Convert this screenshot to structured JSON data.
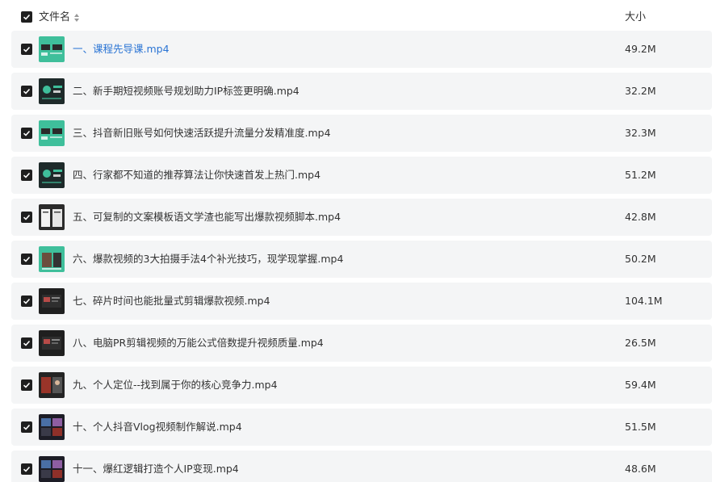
{
  "header": {
    "name_label": "文件名",
    "size_label": "大小"
  },
  "files": [
    {
      "name": "一、课程先导课.mp4",
      "size": "49.2M",
      "thumb": "green",
      "active": true
    },
    {
      "name": "二、新手期短视频账号规划助力IP标签更明确.mp4",
      "size": "32.2M",
      "thumb": "dark-green"
    },
    {
      "name": "三、抖音新旧账号如何快速活跃提升流量分发精准度.mp4",
      "size": "32.3M",
      "thumb": "green"
    },
    {
      "name": "四、行家都不知道的推荐算法让你快速首发上热门.mp4",
      "size": "51.2M",
      "thumb": "dark-green"
    },
    {
      "name": "五、可复制的文案模板语文学渣也能写出爆款视频脚本.mp4",
      "size": "42.8M",
      "thumb": "dark-doc"
    },
    {
      "name": "六、爆款视频的3大拍摄手法4个补光技巧，现学现掌握.mp4",
      "size": "50.2M",
      "thumb": "green-photo"
    },
    {
      "name": "七、碎片时间也能批量式剪辑爆款视频.mp4",
      "size": "104.1M",
      "thumb": "dark-screen"
    },
    {
      "name": "八、电脑PR剪辑视频的万能公式倍数提升视频质量.mp4",
      "size": "26.5M",
      "thumb": "dark-screen"
    },
    {
      "name": "九、个人定位--找到属于你的核心竞争力.mp4",
      "size": "59.4M",
      "thumb": "dark-photo"
    },
    {
      "name": "十、个人抖音Vlog视频制作解说.mp4",
      "size": "51.5M",
      "thumb": "dark-grid"
    },
    {
      "name": "十一、爆红逻辑打造个人IP变现.mp4",
      "size": "48.6M",
      "thumb": "dark-grid"
    }
  ]
}
